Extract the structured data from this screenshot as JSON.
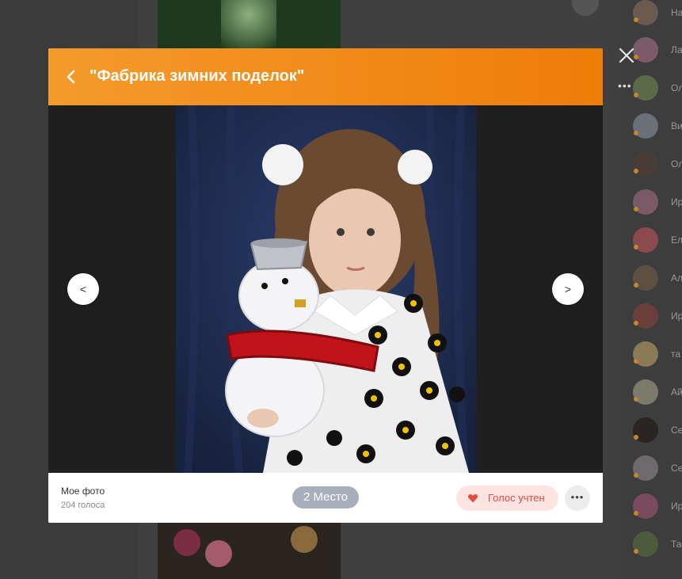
{
  "modal": {
    "title": "\"Фабрика зимних поделок\"",
    "nav_prev_label": "<",
    "nav_next_label": ">",
    "footer": {
      "author": "Мое фото",
      "votes": "204 голоса",
      "place": "2 Место",
      "vote_button": "Голос учтен",
      "more_label": "•••"
    }
  },
  "overlay": {
    "more_label": "•••"
  },
  "friends": [
    {
      "name": "На"
    },
    {
      "name": "Ла"
    },
    {
      "name": "Ол"
    },
    {
      "name": "Ви"
    },
    {
      "name": "Ол"
    },
    {
      "name": "Ир"
    },
    {
      "name": "Ел"
    },
    {
      "name": "Ал"
    },
    {
      "name": "Ир"
    },
    {
      "name": "та"
    },
    {
      "name": "Ай"
    },
    {
      "name": "Се"
    },
    {
      "name": "Се"
    },
    {
      "name": "Ир"
    },
    {
      "name": "Та"
    }
  ],
  "colors": {
    "accent": "#ee7d07",
    "badge": "#a8aebb",
    "vote": "#e14a3c"
  }
}
